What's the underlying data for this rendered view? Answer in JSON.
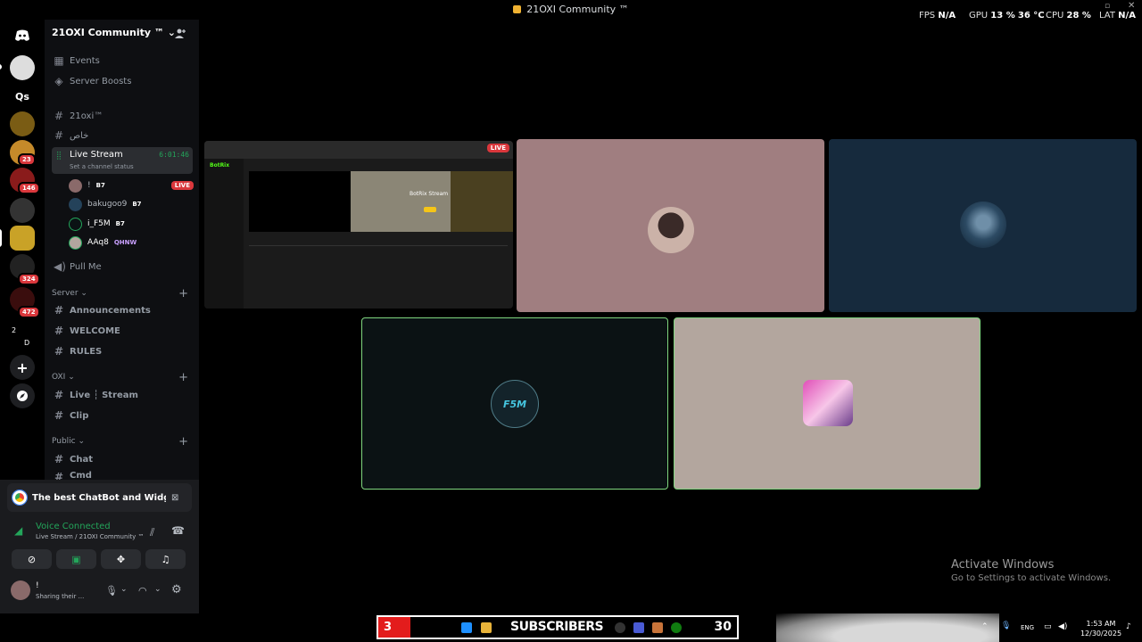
{
  "window": {
    "title": "21OXI Community ™"
  },
  "stats": {
    "fps_label": "FPS",
    "fps_value": "N/A",
    "gpu_label": "GPU",
    "gpu_value": "13 %",
    "gpu_temp": "36 °C",
    "cpu_label": "CPU",
    "cpu_value": "28 %",
    "lat_label": "LAT",
    "lat_value": "N/A"
  },
  "servers": {
    "qs_label": "Qs",
    "badges": [
      "23",
      "146",
      "324",
      "472"
    ],
    "folder_text": [
      "2",
      "D"
    ]
  },
  "sidebar": {
    "server_name": "21OXI Community ™",
    "top_items": [
      "Events",
      "Server Boosts"
    ],
    "channels_top": [
      "21oxi™",
      "خاص"
    ],
    "live_channel": {
      "name": "Live Stream",
      "timer": "6:01:46",
      "status": "Set a channel status"
    },
    "voice_users": [
      {
        "name": "!",
        "tag": "B7",
        "live": "LIVE"
      },
      {
        "name": "bakugoo9",
        "tag": "B7"
      },
      {
        "name": "i_F5M",
        "tag": "B7"
      },
      {
        "name": "AAq8",
        "tag": "QHNW"
      }
    ],
    "pull_me": "Pull Me",
    "categories": [
      {
        "name": "Server",
        "channels": [
          "Announcements",
          "WELCOME",
          "RULES"
        ]
      },
      {
        "name": "OXI",
        "channels": [
          "Live ┆ Stream",
          "Clip"
        ]
      },
      {
        "name": "Public",
        "channels": [
          "Chat",
          "Cmd"
        ]
      }
    ]
  },
  "panel": {
    "activity": "The best ChatBot and Widget...",
    "voice_connected": "Voice Connected",
    "voice_sub": "Live Stream / 21OXI Community ™",
    "user_name": "!",
    "user_status": "Sharing their ..."
  },
  "stream": {
    "live_badge": "LIVE",
    "site_logo": "BotRix",
    "overlay_text": "BotRix Stream",
    "f5m_logo": "F5M"
  },
  "watermark": {
    "line1": "Activate Windows",
    "line2": "Go to Settings to activate Windows."
  },
  "taskbar": {
    "sub_count": "3",
    "sub_label": "SUBSCRIBERS",
    "sub_goal": "30",
    "lang": "ENG",
    "time": "1:53 AM",
    "date": "12/30/2025"
  },
  "colors": {
    "accent_green": "#23a55a",
    "live_red": "#da373c",
    "tile_pink": "#a07e80",
    "tile_blue": "#162a3d",
    "tile_dark": "#0b1214",
    "tile_beige": "#b3a69e"
  }
}
